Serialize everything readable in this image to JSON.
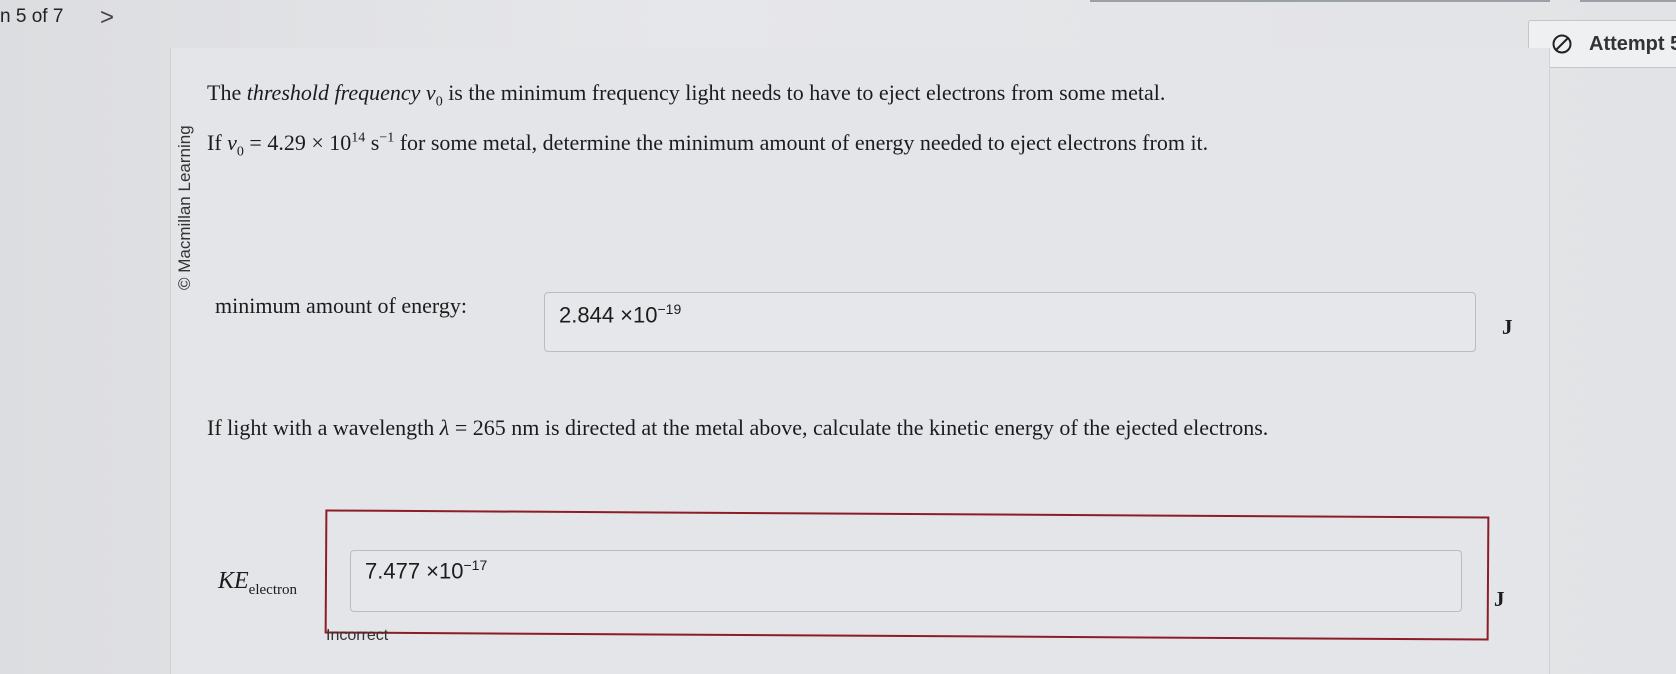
{
  "nav": {
    "counter": "n 5 of 7",
    "next": ">"
  },
  "attempt": {
    "label": "Attempt 5",
    "icon": "no-entry-icon"
  },
  "credit": "© Macmillan Learning",
  "question": {
    "p1": {
      "a": "The ",
      "term": "threshold frequency",
      "b": " ",
      "sym": "v",
      "sub": "0",
      "c": " is the minimum frequency light needs to have to eject electrons from some metal."
    },
    "p2": {
      "a": "If ",
      "sym": "v",
      "sub": "0",
      "eq": " = 4.29 × 10",
      "exp": "14",
      "unit": " s",
      "unit_exp": "−1",
      "rest": " for some metal, determine the minimum amount of energy needed to eject electrons from it."
    },
    "p3": {
      "a": "If light with a wavelength ",
      "sym": "λ",
      "rest": " = 265 nm is directed at the metal above, calculate the kinetic energy of the ejected electrons."
    }
  },
  "answer1": {
    "label": "minimum amount of energy:",
    "mantissa": "2.844",
    "times": " ×10",
    "exponent": "−19",
    "unit": "J"
  },
  "answer2": {
    "label_sym": "KE",
    "label_sub": "electron",
    "mantissa": "7.477",
    "times": " ×10",
    "exponent": "−17",
    "unit": "J",
    "feedback": "Incorrect"
  },
  "colors": {
    "error": "#8c1d27"
  }
}
